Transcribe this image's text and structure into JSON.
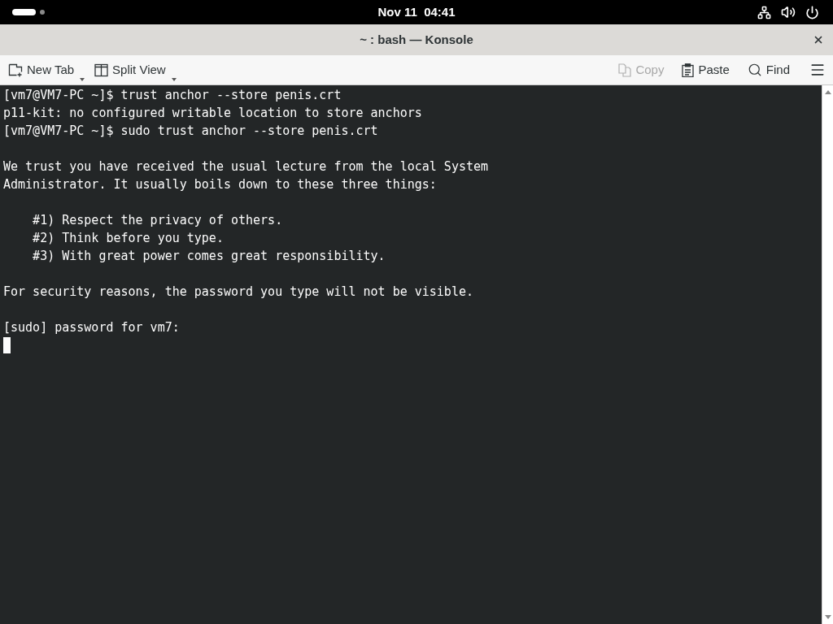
{
  "top_bar": {
    "clock": "Nov 11  04:41"
  },
  "window": {
    "title": "~ : bash — Konsole"
  },
  "toolbar": {
    "left": [
      {
        "kind": "new_tab",
        "label": "New Tab",
        "has_menu": true,
        "disabled": false
      },
      {
        "kind": "split_view",
        "label": "Split View",
        "has_menu": true,
        "disabled": false
      }
    ],
    "right": [
      {
        "kind": "copy",
        "label": "Copy",
        "has_menu": false,
        "disabled": true
      },
      {
        "kind": "paste",
        "label": "Paste",
        "has_menu": false,
        "disabled": false
      },
      {
        "kind": "find",
        "label": "Find",
        "has_menu": false,
        "disabled": false
      }
    ]
  },
  "terminal": {
    "blocks": [
      [
        "[vm7@VM7-PC ~]$ trust anchor --store penis.crt",
        "p11-kit: no configured writable location to store anchors",
        "[vm7@VM7-PC ~]$ sudo trust anchor --store penis.crt"
      ],
      [
        "We trust you have received the usual lecture from the local System",
        "Administrator. It usually boils down to these three things:"
      ],
      [
        "    #1) Respect the privacy of others.",
        "    #2) Think before you type.",
        "    #3) With great power comes great responsibility."
      ],
      [
        "For security reasons, the password you type will not be visible."
      ],
      [
        "[sudo] password for vm7:"
      ]
    ],
    "cursor": true
  }
}
